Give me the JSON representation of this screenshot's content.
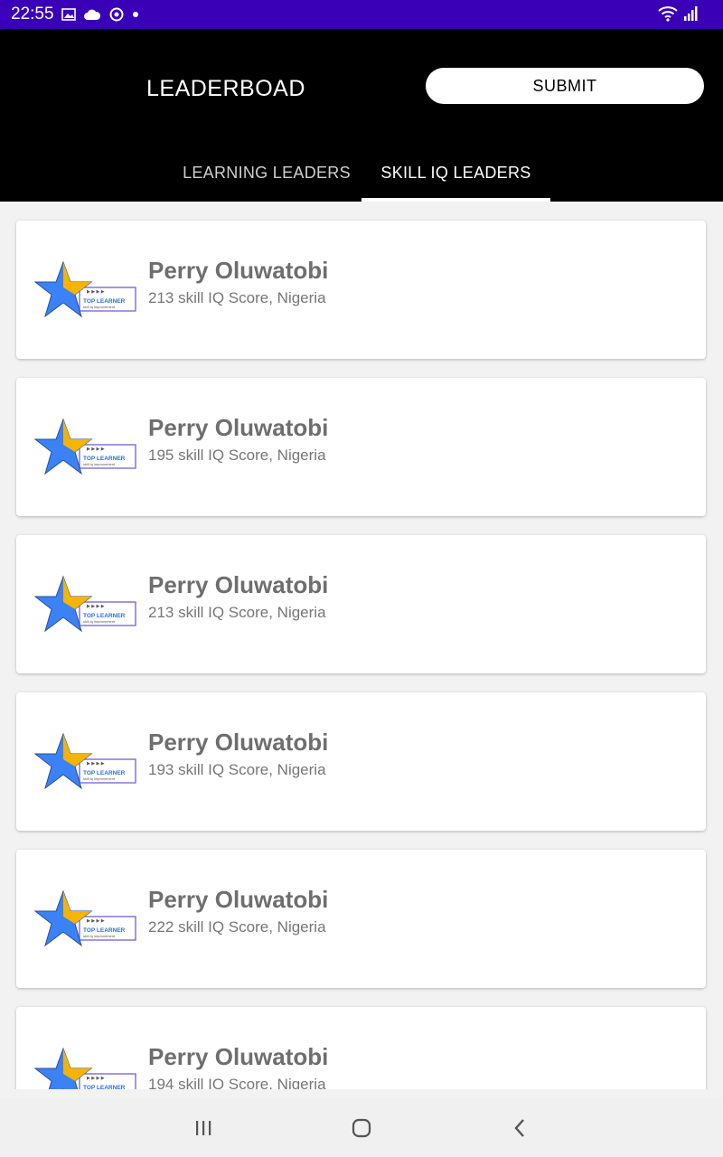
{
  "status_bar": {
    "time": "22:55",
    "left_icons": [
      "image-icon",
      "cloud-icon",
      "sync-icon",
      "dot-icon"
    ],
    "right_icons": [
      "wifi-icon",
      "signal-icon"
    ],
    "bg_color": "#3a00b8"
  },
  "header": {
    "title": "LEADERBOAD",
    "submit_label": "SUBMIT"
  },
  "tabs": [
    {
      "label": "LEARNING LEADERS",
      "selected": false
    },
    {
      "label": "SKILL IQ LEADERS",
      "selected": true
    }
  ],
  "leaders": [
    {
      "name": "Perry Oluwatobi",
      "detail": "213 skill IQ Score, Nigeria"
    },
    {
      "name": "Perry Oluwatobi",
      "detail": "195 skill IQ Score, Nigeria"
    },
    {
      "name": "Perry Oluwatobi",
      "detail": "213 skill IQ Score, Nigeria"
    },
    {
      "name": "Perry Oluwatobi",
      "detail": "193 skill IQ Score, Nigeria"
    },
    {
      "name": "Perry Oluwatobi",
      "detail": "222 skill IQ Score, Nigeria"
    },
    {
      "name": "Perry Oluwatobi",
      "detail": "194 skill IQ Score, Nigeria"
    }
  ],
  "badge": {
    "label": "TOP LEARNER",
    "star_color": "#3b82f6",
    "star_accent": "#f4b400"
  },
  "nav_bar": [
    "recent-apps-icon",
    "home-icon",
    "back-icon"
  ]
}
